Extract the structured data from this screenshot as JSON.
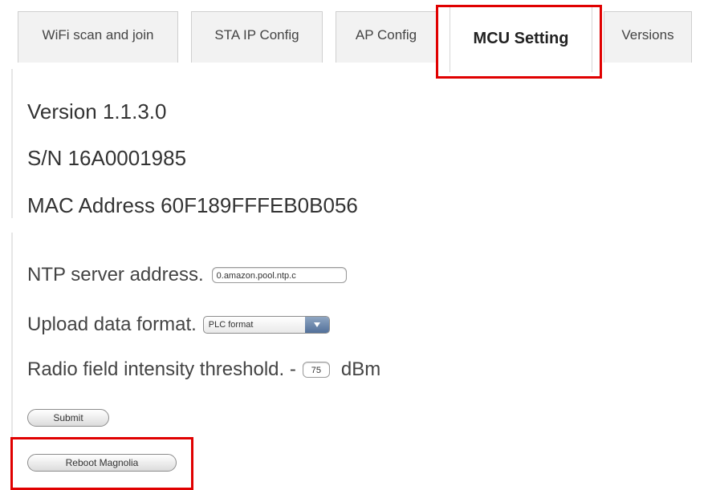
{
  "tabs": [
    {
      "label": "WiFi scan and join"
    },
    {
      "label": "STA IP Config"
    },
    {
      "label": "AP Config"
    },
    {
      "label": "MCU Setting",
      "active": true
    },
    {
      "label": "Versions"
    }
  ],
  "info": {
    "version": "Version 1.1.3.0",
    "serial": "S/N 16A0001985",
    "mac": "MAC Address 60F189FFFEB0B056"
  },
  "settings": {
    "ntp_label": "NTP server address.",
    "ntp_value": "0.amazon.pool.ntp.c",
    "upload_label": "Upload data format.",
    "upload_value": "PLC format",
    "radio_label": "Radio field intensity threshold. -",
    "radio_value": "75",
    "radio_unit": "dBm"
  },
  "buttons": {
    "submit": "Submit",
    "reboot": "Reboot Magnolia"
  },
  "colors": {
    "highlight": "#e00000",
    "select_arrow": "#52709a"
  }
}
